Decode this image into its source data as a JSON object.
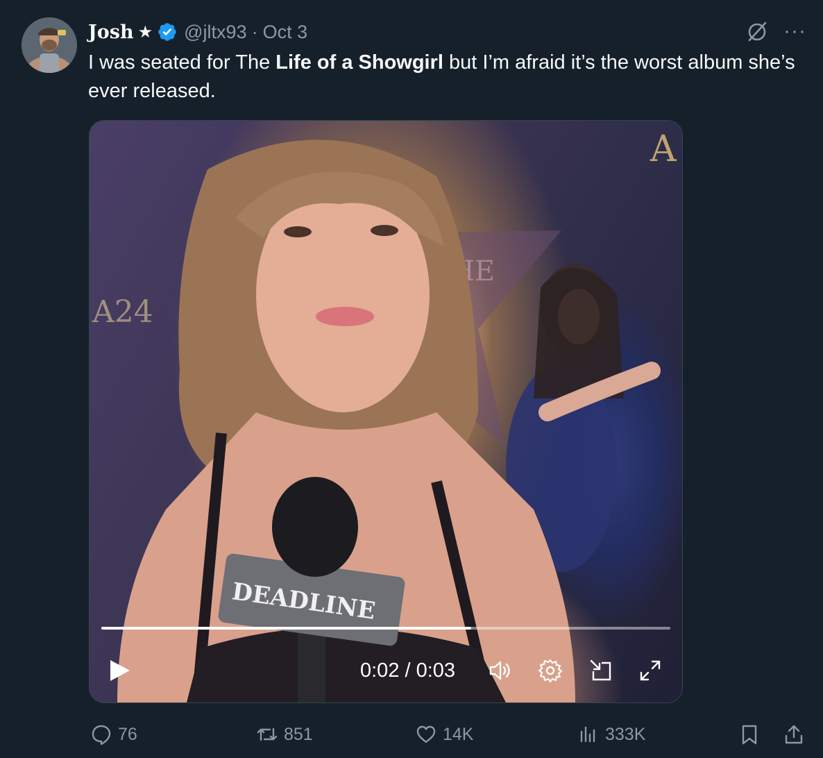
{
  "author": {
    "name": "Josh",
    "badge": "★",
    "handle": "@jltx93",
    "separator": "·",
    "date": "Oct 3"
  },
  "tweet": {
    "text_before": "I was seated for The ",
    "text_bold": "Life of a Showgirl",
    "text_after": " but I’m afraid it’s the worst album she’s ever released."
  },
  "video": {
    "time": "0:02 / 0:03",
    "progress": 0.65,
    "mic_label": "DEADLINE"
  },
  "actions": {
    "replies": "76",
    "reposts": "851",
    "likes": "14K",
    "views": "333K"
  },
  "colors": {
    "background": "#15202b",
    "text": "#f7f9f9",
    "muted": "#8b98a5",
    "verified": "#1d9bf0"
  }
}
